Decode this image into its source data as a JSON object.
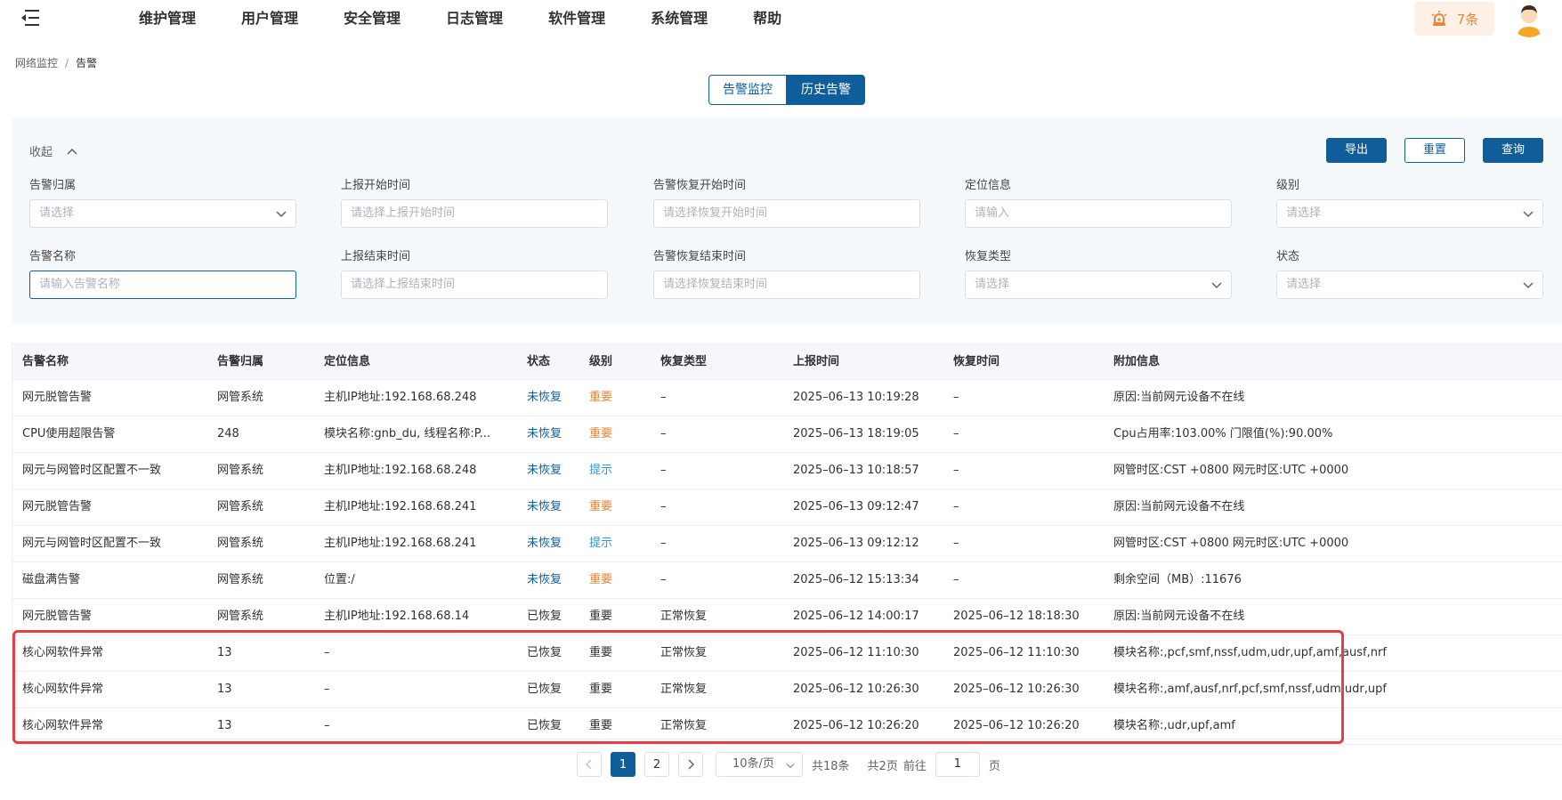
{
  "header": {
    "nav": [
      "维护管理",
      "用户管理",
      "安全管理",
      "日志管理",
      "软件管理",
      "系统管理",
      "帮助"
    ],
    "alarm_count": "7条",
    "alarm_color": "#e8853a"
  },
  "breadcrumb": {
    "parent": "网络监控",
    "separator": "/",
    "current": "告警"
  },
  "tabs": {
    "monitor": "告警监控",
    "history": "历史告警"
  },
  "filter": {
    "collapse_label": "收起",
    "buttons": {
      "export": "导出",
      "reset": "重置",
      "query": "查询"
    },
    "fields": [
      {
        "label": "告警归属",
        "placeholder": "请选择"
      },
      {
        "label": "上报开始时间",
        "placeholder": "请选择上报开始时间"
      },
      {
        "label": "告警恢复开始时间",
        "placeholder": "请选择恢复开始时间"
      },
      {
        "label": "定位信息",
        "placeholder": "请输入"
      },
      {
        "label": "级别",
        "placeholder": "请选择"
      },
      {
        "label": "告警名称",
        "placeholder": "请输入告警名称"
      },
      {
        "label": "上报结束时间",
        "placeholder": "请选择上报结束时间"
      },
      {
        "label": "告警恢复结束时间",
        "placeholder": "请选择恢复结束时间"
      },
      {
        "label": "恢复类型",
        "placeholder": "请选择"
      },
      {
        "label": "状态",
        "placeholder": "请选择"
      }
    ]
  },
  "table": {
    "columns": [
      "告警名称",
      "告警归属",
      "定位信息",
      "状态",
      "级别",
      "恢复类型",
      "上报时间",
      "恢复时间",
      "附加信息"
    ],
    "rows": [
      [
        "网元脱管告警",
        "网管系统",
        "主机IP地址:192.168.68.248",
        "未恢复",
        "重要",
        "–",
        "2025–06–13 10:19:28",
        "–",
        "原因:当前网元设备不在线"
      ],
      [
        "CPU使用超限告警",
        "248",
        "模块名称:gnb_du, 线程名称:P...",
        "未恢复",
        "重要",
        "–",
        "2025–06–13 18:19:05",
        "–",
        "Cpu占用率:103.00% 门限值(%):90.00%"
      ],
      [
        "网元与网管时区配置不一致",
        "网管系统",
        "主机IP地址:192.168.68.248",
        "未恢复",
        "提示",
        "–",
        "2025–06–13 10:18:57",
        "–",
        "网管时区:CST +0800 网元时区:UTC +0000"
      ],
      [
        "网元脱管告警",
        "网管系统",
        "主机IP地址:192.168.68.241",
        "未恢复",
        "重要",
        "–",
        "2025–06–13 09:12:47",
        "–",
        "原因:当前网元设备不在线"
      ],
      [
        "网元与网管时区配置不一致",
        "网管系统",
        "主机IP地址:192.168.68.241",
        "未恢复",
        "提示",
        "–",
        "2025–06–13 09:12:12",
        "–",
        "网管时区:CST +0800 网元时区:UTC +0000"
      ],
      [
        "磁盘满告警",
        "网管系统",
        "位置:/",
        "未恢复",
        "重要",
        "–",
        "2025–06–12 15:13:34",
        "–",
        "剩余空间（MB）:11676"
      ],
      [
        "网元脱管告警",
        "网管系统",
        "主机IP地址:192.168.68.14",
        "已恢复",
        "重要",
        "正常恢复",
        "2025–06–12 14:00:17",
        "2025–06–12 18:18:30",
        "原因:当前网元设备不在线"
      ],
      [
        "核心网软件异常",
        "13",
        "–",
        "已恢复",
        "重要",
        "正常恢复",
        "2025–06–12 11:10:30",
        "2025–06–12 11:10:30",
        "模块名称:,pcf,smf,nssf,udm,udr,upf,amf,ausf,nrf"
      ],
      [
        "核心网软件异常",
        "13",
        "–",
        "已恢复",
        "重要",
        "正常恢复",
        "2025–06–12 10:26:30",
        "2025–06–12 10:26:30",
        "模块名称:,amf,ausf,nrf,pcf,smf,nssf,udm,udr,upf"
      ],
      [
        "核心网软件异常",
        "13",
        "–",
        "已恢复",
        "重要",
        "正常恢复",
        "2025–06–12 10:26:20",
        "2025–06–12 10:26:20",
        "模块名称:,udr,upf,amf"
      ]
    ]
  },
  "pagination": {
    "pages": [
      "1",
      "2"
    ],
    "current": "1",
    "page_size": "10条/页",
    "total": "共18条",
    "total_pages": "共2页",
    "goto_label": "前往",
    "goto_value": "1",
    "page_unit": "页"
  }
}
